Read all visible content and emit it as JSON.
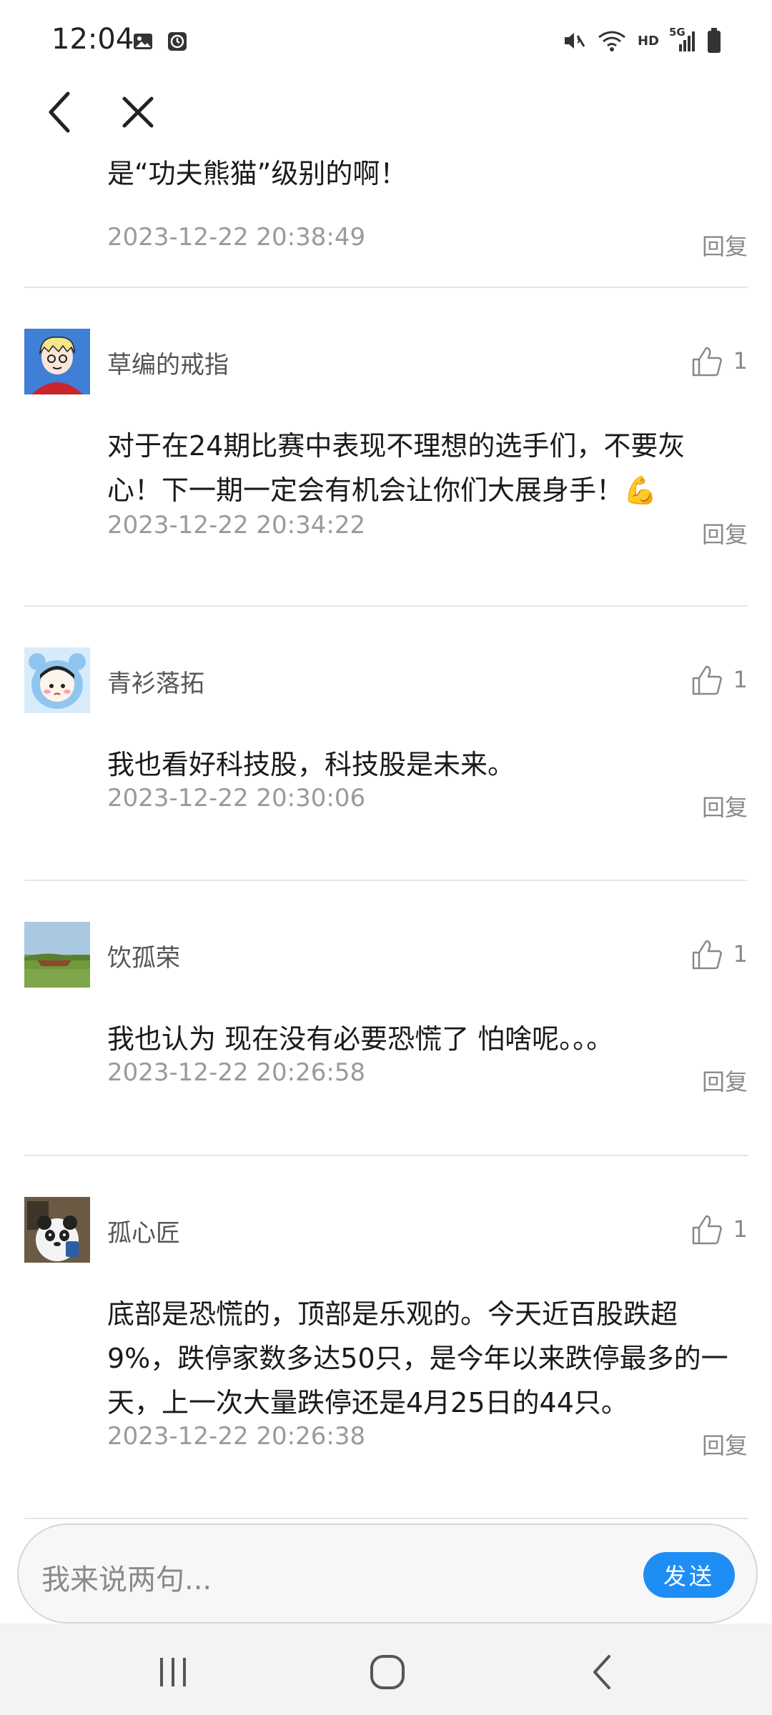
{
  "status_bar": {
    "time": "12:04",
    "left_icons": [
      "image-icon",
      "clock-icon"
    ],
    "right_icons": [
      "mute-icon",
      "wifi-icon",
      "hd-icon",
      "signal-5g-icon",
      "battery-icon"
    ],
    "hd_label": "HD",
    "network_label": "5G"
  },
  "nav": {
    "back_icon": "back-arrow-icon",
    "close_icon": "close-icon"
  },
  "first_comment": {
    "text": "是“功夫熊猫”级别的啊！",
    "time": "2023-12-22 20:38:49",
    "reply": "回复"
  },
  "comments": [
    {
      "username": "草编的戒指",
      "likes": "1",
      "body": "对于在24期比赛中表现不理想的选手们，不要灰心！下一期一定会有机会让你们大展身手！💪",
      "time": "2023-12-22 20:34:22",
      "reply": "回复"
    },
    {
      "username": "青衫落拓",
      "likes": "1",
      "body": "我也看好科技股，科技股是未来。",
      "time": "2023-12-22 20:30:06",
      "reply": "回复"
    },
    {
      "username": "饮孤荣",
      "likes": "1",
      "body": "我也认为 现在没有必要恐慌了 怕啥呢。。。",
      "time": "2023-12-22 20:26:58",
      "reply": "回复"
    },
    {
      "username": "孤心匠",
      "likes": "1",
      "body": "底部是恐慌的，顶部是乐观的。今天近百股跌超9%，跌停家数多达50只，是今年以来跌停最多的一天，上一次大量跌停还是4月25日的44只。",
      "time": "2023-12-22 20:26:38",
      "reply": "回复"
    }
  ],
  "input": {
    "placeholder": "我来说两句...",
    "send_label": "发送"
  },
  "colors": {
    "accent": "#1e8ef5",
    "divider": "#e6e6e6",
    "meta_text": "#9a9a9a"
  }
}
